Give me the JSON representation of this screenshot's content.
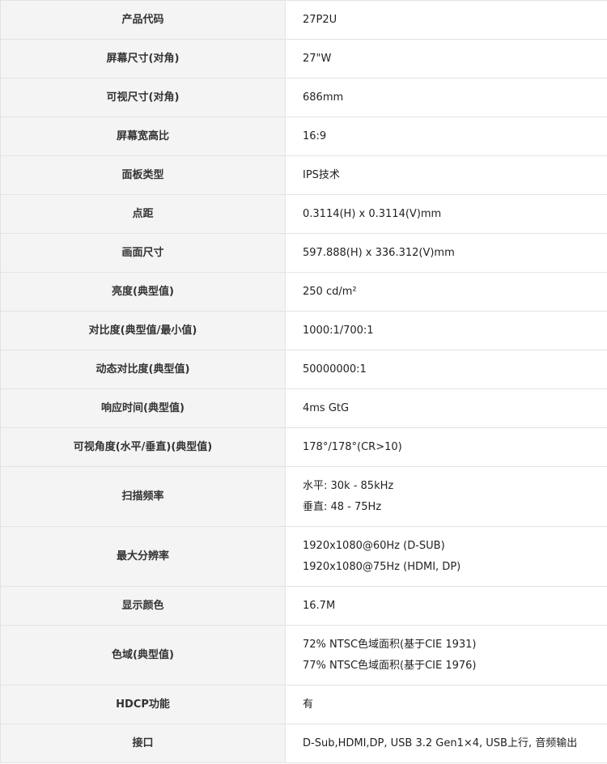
{
  "rows": [
    {
      "label": "产品代码",
      "lines": [
        "27P2U"
      ]
    },
    {
      "label": "屏幕尺寸(对角)",
      "lines": [
        "27\"W"
      ]
    },
    {
      "label": "可视尺寸(对角)",
      "lines": [
        "686mm"
      ]
    },
    {
      "label": "屏幕宽高比",
      "lines": [
        "16:9"
      ]
    },
    {
      "label": "面板类型",
      "lines": [
        "IPS技术"
      ]
    },
    {
      "label": "点距",
      "lines": [
        "0.3114(H)    x 0.3114(V)mm"
      ]
    },
    {
      "label": "画面尺寸",
      "lines": [
        "597.888(H)    x 336.312(V)mm"
      ]
    },
    {
      "label": "亮度(典型值)",
      "lines": [
        "250    cd/m²"
      ]
    },
    {
      "label": "对比度(典型值/最小值)",
      "lines": [
        "1000:1/700:1"
      ]
    },
    {
      "label": "动态对比度(典型值)",
      "lines": [
        "50000000:1"
      ]
    },
    {
      "label": "响应时间(典型值)",
      "lines": [
        "4ms    GtG"
      ]
    },
    {
      "label": "可视角度(水平/垂直)(典型值)",
      "lines": [
        "178°/178°(CR>10)"
      ]
    },
    {
      "label": "扫描频率",
      "lines": [
        "水平: 30k - 85kHz",
        "垂直: 48 - 75Hz"
      ]
    },
    {
      "label": "最大分辨率",
      "lines": [
        "1920x1080@60Hz    (D-SUB)",
        "1920x1080@75Hz (HDMI, DP)"
      ]
    },
    {
      "label": "显示颜色",
      "lines": [
        "16.7M"
      ]
    },
    {
      "label": "色域(典型值)",
      "lines": [
        "72%    NTSC色域面积(基于CIE 1931)",
        "77% NTSC色域面积(基于CIE 1976)"
      ]
    },
    {
      "label": "HDCP功能",
      "lines": [
        "有"
      ]
    },
    {
      "label": "接口",
      "lines": [
        "D-Sub,HDMI,DP,    USB 3.2 Gen1×4, USB上行, 音频输出"
      ]
    }
  ]
}
